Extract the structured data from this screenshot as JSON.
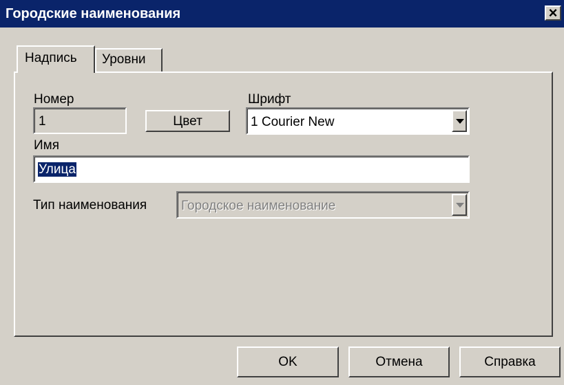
{
  "window": {
    "title": "Городские наименования",
    "close_label": "×"
  },
  "tabs": [
    {
      "label": "Надпись",
      "active": true
    },
    {
      "label": "Уровни",
      "active": false
    }
  ],
  "form": {
    "number_label": "Номер",
    "number_value": "1",
    "color_button": "Цвет",
    "font_label": "Шрифт",
    "font_value": "1 Courier New",
    "name_label": "Имя",
    "name_value": "Улица",
    "type_label": "Тип наименования",
    "type_value": "Городское наименование"
  },
  "buttons": {
    "ok": "OK",
    "cancel": "Отмена",
    "help": "Справка"
  },
  "colors": {
    "titlebar": "#0a246a",
    "face": "#d4d0c8",
    "selection": "#0a246a"
  }
}
